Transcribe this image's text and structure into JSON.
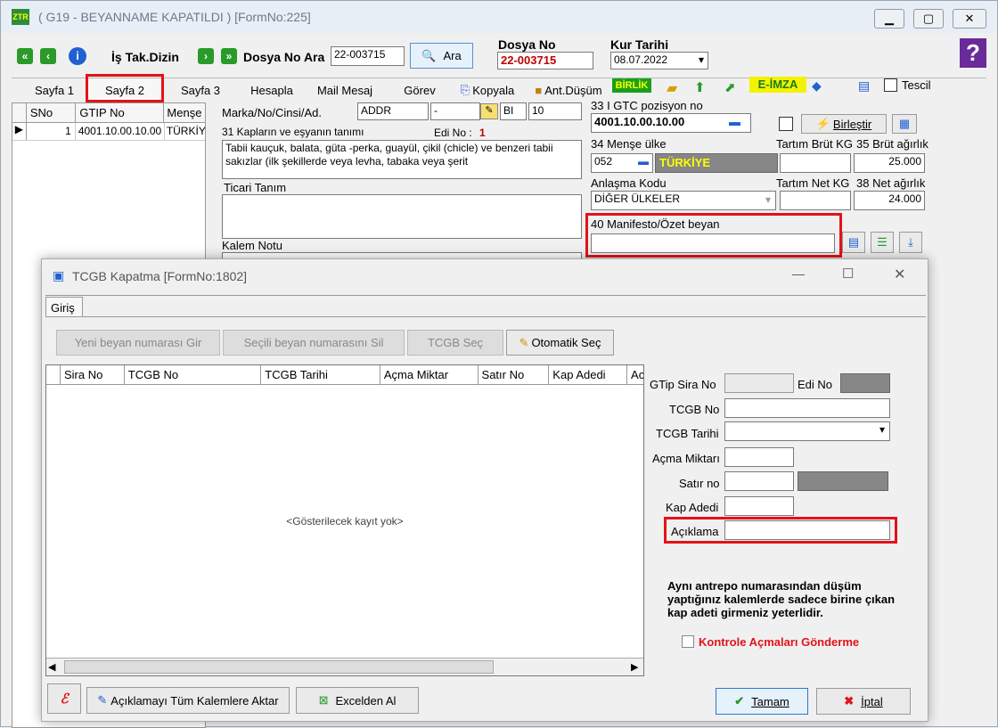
{
  "window": {
    "title": "( G19 - BEYANNAME KAPATILDI ) [FormNo:225]"
  },
  "toolbar": {
    "is_tak_dizin": "İş Tak.Dizin",
    "dosya_no_ara_label": "Dosya No Ara",
    "dosya_no_input": "22-003715",
    "ara_button": "Ara",
    "dosya_no_label": "Dosya No",
    "dosya_no_value": "22-003715",
    "kur_tarihi_label": "Kur Tarihi",
    "kur_tarihi_value": "08.07.2022"
  },
  "tabs": [
    "Sayfa 1",
    "Sayfa 2",
    "Sayfa 3",
    "Hesapla",
    "Mail Mesaj",
    "Görev",
    "Kopyala",
    "Ant.Düşüm"
  ],
  "tab_extras": {
    "birlik": "BİRLİK",
    "e_imza": "E-İMZA",
    "tescil": "Tescil"
  },
  "items_grid": {
    "headers": [
      "SNo",
      "GTIP No",
      "Menşe"
    ],
    "rows": [
      {
        "sno": "1",
        "gtip": "4001.10.00.10.00",
        "mense": "TÜRKİY"
      }
    ]
  },
  "form": {
    "marka_label": "Marka/No/Cinsi/Ad.",
    "marka_value": "ADDR",
    "marka_dash": "-",
    "marka_bi": "BI",
    "marka_qty": "10",
    "kaplar_label": "31 Kapların ve eşyanın tanımı",
    "edi_no_label": "Edi No :",
    "edi_no_value": "1",
    "kaplar_text": "Tabii kauçuk, balata, güta -perka, guayül, çikil (chicle) ve benzeri tabii sakızlar (ilk şekillerde veya levha, tabaka veya şerit",
    "ticari_label": "Ticari Tanım",
    "kalem_notu_label": "Kalem Notu",
    "gtc_label": "33 I GTC pozisyon no",
    "gtc_value": "4001.10.00.10.00",
    "birlestir": "Birleştir",
    "mense_label": "34 Menşe ülke",
    "mense_code": "052",
    "mense_name": "TÜRKİYE",
    "brut_label": "Tartım Brüt KG",
    "brut35_label": "35 Brüt ağırlık",
    "brut35_value": "25.000",
    "anlasma_label": "Anlaşma Kodu",
    "anlasma_value": "DİĞER ÜLKELER",
    "net_label": "Tartım Net KG",
    "net38_label": "38 Net ağırlık",
    "net38_value": "24.000",
    "manifesto_label": "40 Manifesto/Özet beyan"
  },
  "dialog": {
    "title": "TCGB Kapatma [FormNo:1802]",
    "tab": "Giriş",
    "buttons": {
      "yeni": "Yeni beyan numarası Gir",
      "secili": "Seçili beyan numarasını Sil",
      "tcgb_sec": "TCGB Seç",
      "otomatik": "Otomatik Seç"
    },
    "grid_headers": [
      "Sira No",
      "TCGB No",
      "TCGB Tarihi",
      "Açma Miktar",
      "Satır No",
      "Kap Adedi",
      "Ac"
    ],
    "empty_text": "<Gösterilecek kayıt yok>",
    "fields": {
      "gtip_sira": "GTip Sira No",
      "edi_no": "Edi No",
      "tcgb_no": "TCGB No",
      "tcgb_tarihi": "TCGB Tarihi",
      "acma_miktari": "Açma Miktarı",
      "satir_no": "Satır no",
      "kap_adedi": "Kap Adedi",
      "aciklama": "Açıklama"
    },
    "note": "Aynı antrepo numarasından düşüm yaptığınız kalemlerde sadece birine çıkan kap adeti girmeniz yeterlidir.",
    "kontrole": "Kontrole Açmaları Gönderme",
    "bottom": {
      "aktar": "Açıklamayı Tüm Kalemlere Aktar",
      "excel": "Excelden Al",
      "tamam": "Tamam",
      "iptal": "İptal"
    }
  },
  "colors": {
    "red_highlight": "#e3121a",
    "green": "#2e8b2e",
    "birlik_bg": "#1aa01a",
    "eimza_bg": "#f3f300"
  }
}
